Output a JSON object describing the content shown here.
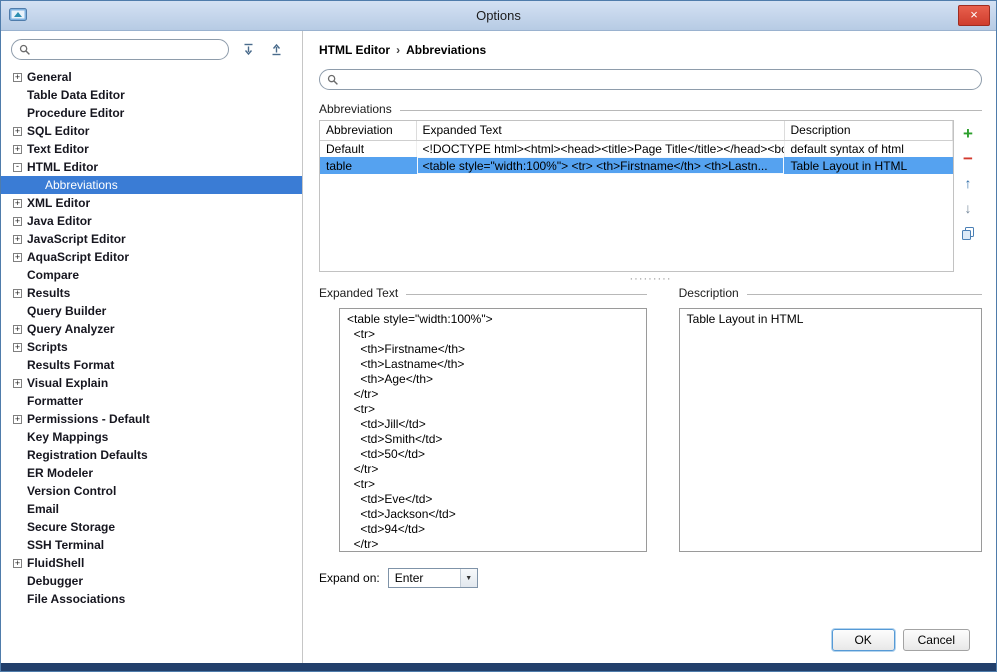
{
  "window": {
    "title": "Options"
  },
  "icons": {
    "close_glyph": "×",
    "search": "magnifier-icon",
    "expand_all": "expand-all-icon",
    "collapse_all": "collapse-all-icon",
    "add_glyph": "+",
    "remove_glyph": "−",
    "up_glyph": "↑",
    "down_glyph": "↓",
    "copy": "copy-pages-icon",
    "combo_arrow": "▼",
    "breadcrumb_sep": "›"
  },
  "sidebar": {
    "search": {
      "placeholder": ""
    },
    "tree": [
      {
        "label": "General",
        "toggle": "plus"
      },
      {
        "label": "Table Data Editor",
        "toggle": "none"
      },
      {
        "label": "Procedure Editor",
        "toggle": "none"
      },
      {
        "label": "SQL Editor",
        "toggle": "plus"
      },
      {
        "label": "Text Editor",
        "toggle": "plus"
      },
      {
        "label": "HTML Editor",
        "toggle": "minus"
      },
      {
        "label": "Abbreviations",
        "toggle": "none",
        "child": true,
        "selected": true
      },
      {
        "label": "XML Editor",
        "toggle": "plus"
      },
      {
        "label": "Java Editor",
        "toggle": "plus"
      },
      {
        "label": "JavaScript Editor",
        "toggle": "plus"
      },
      {
        "label": "AquaScript Editor",
        "toggle": "plus"
      },
      {
        "label": "Compare",
        "toggle": "none"
      },
      {
        "label": "Results",
        "toggle": "plus"
      },
      {
        "label": "Query Builder",
        "toggle": "none"
      },
      {
        "label": "Query Analyzer",
        "toggle": "plus"
      },
      {
        "label": "Scripts",
        "toggle": "plus"
      },
      {
        "label": "Results Format",
        "toggle": "none"
      },
      {
        "label": "Visual Explain",
        "toggle": "plus"
      },
      {
        "label": "Formatter",
        "toggle": "none"
      },
      {
        "label": "Permissions - Default",
        "toggle": "plus"
      },
      {
        "label": "Key Mappings",
        "toggle": "none"
      },
      {
        "label": "Registration Defaults",
        "toggle": "none"
      },
      {
        "label": "ER Modeler",
        "toggle": "none"
      },
      {
        "label": "Version Control",
        "toggle": "none"
      },
      {
        "label": "Email",
        "toggle": "none"
      },
      {
        "label": "Secure Storage",
        "toggle": "none"
      },
      {
        "label": "SSH Terminal",
        "toggle": "none"
      },
      {
        "label": "FluidShell",
        "toggle": "plus"
      },
      {
        "label": "Debugger",
        "toggle": "none"
      },
      {
        "label": "File Associations",
        "toggle": "none"
      }
    ]
  },
  "main": {
    "breadcrumb": {
      "parent": "HTML Editor",
      "current": "Abbreviations"
    },
    "search": {
      "placeholder": ""
    },
    "abbreviations": {
      "group_title": "Abbreviations",
      "columns": [
        "Abbreviation",
        "Expanded Text",
        "Description"
      ],
      "rows": [
        {
          "abbreviation": "Default",
          "expanded_text": "<!DOCTYPE html><html><head><title>Page Title</title></head><bod...",
          "description": "default syntax of html"
        },
        {
          "abbreviation": "table",
          "expanded_text": "<table style=\"width:100%\">  <tr>    <th>Firstname</th>    <th>Lastn...",
          "description": "Table Layout in HTML"
        }
      ]
    },
    "expanded_text": {
      "group_title": "Expanded Text",
      "content": "<table style=\"width:100%\">\n  <tr>\n    <th>Firstname</th>\n    <th>Lastname</th>\n    <th>Age</th>\n  </tr>\n  <tr>\n    <td>Jill</td>\n    <td>Smith</td>\n    <td>50</td>\n  </tr>\n  <tr>\n    <td>Eve</td>\n    <td>Jackson</td>\n    <td>94</td>\n  </tr>\n</table>"
    },
    "description": {
      "group_title": "Description",
      "content": "Table Layout in HTML"
    },
    "expand_on": {
      "label": "Expand on:",
      "value": "Enter"
    },
    "footer": {
      "ok_label": "OK",
      "cancel_label": "Cancel"
    }
  }
}
